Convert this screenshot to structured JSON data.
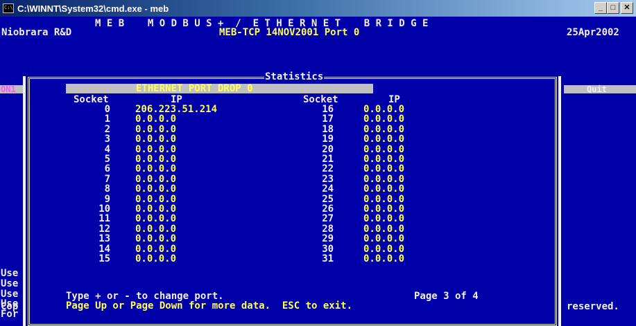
{
  "window": {
    "title": "C:\\WINNT\\System32\\cmd.exe - meb",
    "buttons": [
      "minimize",
      "maximize",
      "close"
    ]
  },
  "banner": {
    "title": "M E B    M O D B U S +  /  E T H E R N E T    B R I D G E",
    "company": "Niobrara R&D",
    "version": "MEB-TCP 14NOV2001 Port 0",
    "date": "25Apr2002"
  },
  "menu": {
    "left": "ON1",
    "right": "Quit"
  },
  "dialog": {
    "title": "Statistics",
    "header": "ETHERNET PORT DROP 0",
    "col_socket": "Socket",
    "col_ip": "IP",
    "left_rows": [
      {
        "socket": "0",
        "ip": "206.223.51.214"
      },
      {
        "socket": "1",
        "ip": "0.0.0.0"
      },
      {
        "socket": "2",
        "ip": "0.0.0.0"
      },
      {
        "socket": "3",
        "ip": "0.0.0.0"
      },
      {
        "socket": "4",
        "ip": "0.0.0.0"
      },
      {
        "socket": "5",
        "ip": "0.0.0.0"
      },
      {
        "socket": "6",
        "ip": "0.0.0.0"
      },
      {
        "socket": "7",
        "ip": "0.0.0.0"
      },
      {
        "socket": "8",
        "ip": "0.0.0.0"
      },
      {
        "socket": "9",
        "ip": "0.0.0.0"
      },
      {
        "socket": "10",
        "ip": "0.0.0.0"
      },
      {
        "socket": "11",
        "ip": "0.0.0.0"
      },
      {
        "socket": "12",
        "ip": "0.0.0.0"
      },
      {
        "socket": "13",
        "ip": "0.0.0.0"
      },
      {
        "socket": "14",
        "ip": "0.0.0.0"
      },
      {
        "socket": "15",
        "ip": "0.0.0.0"
      }
    ],
    "right_rows": [
      {
        "socket": "16",
        "ip": "0.0.0.0"
      },
      {
        "socket": "17",
        "ip": "0.0.0.0"
      },
      {
        "socket": "18",
        "ip": "0.0.0.0"
      },
      {
        "socket": "19",
        "ip": "0.0.0.0"
      },
      {
        "socket": "20",
        "ip": "0.0.0.0"
      },
      {
        "socket": "21",
        "ip": "0.0.0.0"
      },
      {
        "socket": "22",
        "ip": "0.0.0.0"
      },
      {
        "socket": "23",
        "ip": "0.0.0.0"
      },
      {
        "socket": "24",
        "ip": "0.0.0.0"
      },
      {
        "socket": "25",
        "ip": "0.0.0.0"
      },
      {
        "socket": "26",
        "ip": "0.0.0.0"
      },
      {
        "socket": "27",
        "ip": "0.0.0.0"
      },
      {
        "socket": "28",
        "ip": "0.0.0.0"
      },
      {
        "socket": "29",
        "ip": "0.0.0.0"
      },
      {
        "socket": "30",
        "ip": "0.0.0.0"
      },
      {
        "socket": "31",
        "ip": "0.0.0.0"
      }
    ],
    "footer_line1": "Type + or - to change port.",
    "page": "Page 3 of 4",
    "footer_line2": "Page Up or Page Down for more data.  ESC to exit."
  },
  "background_left": [
    "Use",
    "Use",
    "Use",
    "Use",
    "For",
    "Cop"
  ],
  "background_right": "reserved.",
  "colors": {
    "background": "#0000a8",
    "text": "#f0f0f0",
    "highlight": "#ffff55",
    "menu_bar": "#c0c0c0"
  }
}
